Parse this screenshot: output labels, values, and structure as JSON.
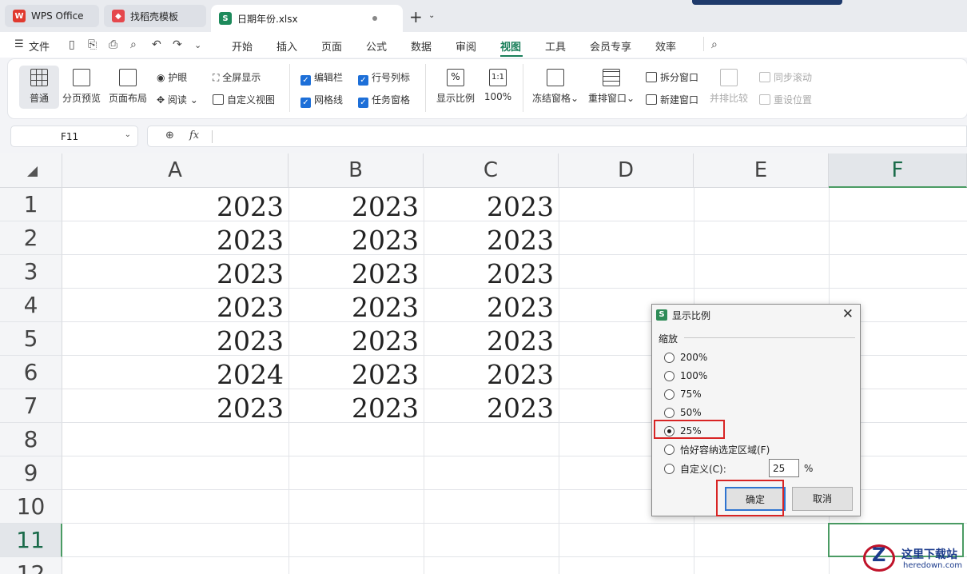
{
  "tabs": [
    {
      "label": "WPS Office",
      "icon": "wps-logo-icon"
    },
    {
      "label": "找稻壳模板",
      "icon": "docer-logo-icon"
    },
    {
      "label": "日期年份.xlsx",
      "icon": "spreadsheet-icon",
      "logo_text": "S"
    }
  ],
  "new_tab": "+",
  "new_tab_caret": "⌄",
  "menu": {
    "file": "文件",
    "items": [
      "开始",
      "插入",
      "页面",
      "公式",
      "数据",
      "审阅",
      "视图",
      "工具",
      "会员专享",
      "效率"
    ],
    "active": "视图"
  },
  "ribbon": {
    "normal": "普通",
    "page_break_preview": "分页预览",
    "page_layout": "页面布局",
    "eye_protect": "护眼",
    "reading": "阅读",
    "full_screen": "全屏显示",
    "custom_view": "自定义视图",
    "formula_bar": "编辑栏",
    "gridlines": "网格线",
    "row_col_headers": "行号列标",
    "task_pane": "任务窗格",
    "zoom": "显示比例",
    "zoom_100": "100%",
    "zoom_100_icon": "1:1",
    "freeze_panes": "冻结窗格",
    "arrange_windows": "重排窗口",
    "split_window": "拆分窗口",
    "new_window": "新建窗口",
    "side_by_side": "并排比较",
    "sync_scroll": "同步滚动",
    "reset_position": "重设位置"
  },
  "formula_bar": {
    "cell_ref": "F11",
    "fx": "fx",
    "value": ""
  },
  "grid": {
    "columns": [
      "A",
      "B",
      "C",
      "D",
      "E",
      "F"
    ],
    "selected_column": "F",
    "rows": [
      "1",
      "2",
      "3",
      "4",
      "5",
      "6",
      "7",
      "8",
      "9",
      "10",
      "11",
      "12"
    ],
    "selected_row": "11",
    "cells": [
      [
        "2023",
        "2023",
        "2023"
      ],
      [
        "2023",
        "2023",
        "2023"
      ],
      [
        "2023",
        "2023",
        "2023"
      ],
      [
        "2023",
        "2023",
        "2023"
      ],
      [
        "2023",
        "2023",
        "2023"
      ],
      [
        "2024",
        "2023",
        "2023"
      ],
      [
        "2023",
        "2023",
        "2023"
      ]
    ]
  },
  "dialog": {
    "title": "显示比例",
    "icon_text": "S",
    "close": "✕",
    "group_label": "缩放",
    "options": [
      "200%",
      "100%",
      "75%",
      "50%",
      "25%",
      "恰好容纳选定区域(F)",
      "自定义(C):"
    ],
    "selected": "25%",
    "custom_value": "25",
    "custom_unit": "%",
    "ok": "确定",
    "cancel": "取消"
  },
  "watermark": {
    "title": "这里下载站",
    "url": "heredown.com",
    "logo_letter": "Z"
  },
  "colors": {
    "accent_green": "#1a7f5a",
    "highlight_red": "#d82424",
    "checkbox_blue": "#1d6fd8"
  }
}
